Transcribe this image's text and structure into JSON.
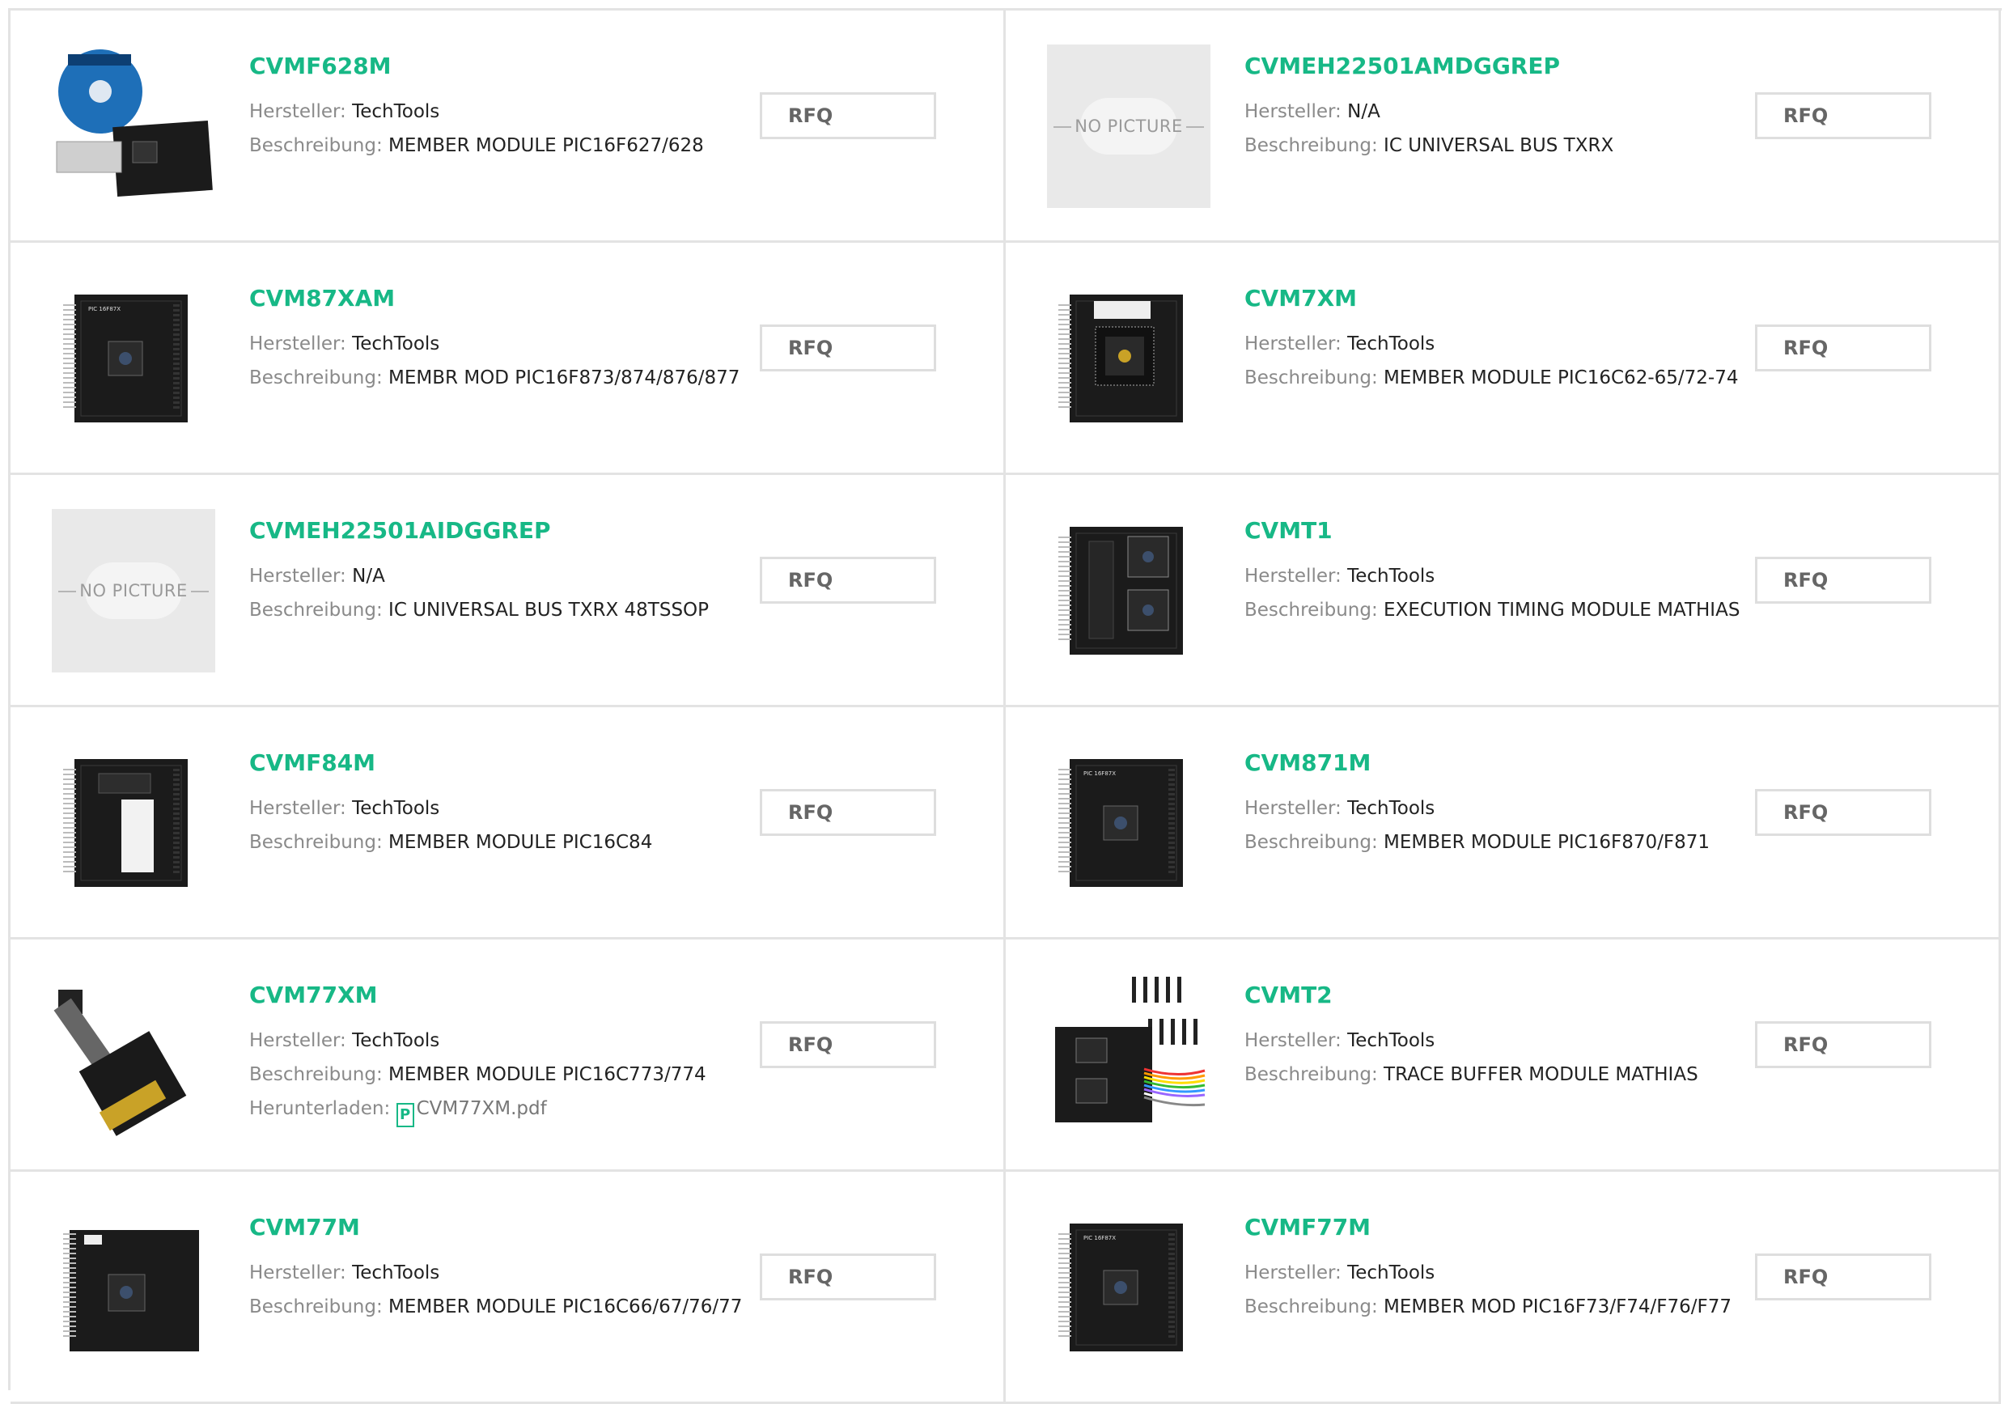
{
  "labels": {
    "manufacturer": "Hersteller:",
    "description": "Beschreibung:",
    "download": "Herunterladen:",
    "no_picture": "NO PICTURE",
    "rfq": "RFQ",
    "pdf_icon_glyph": "P"
  },
  "products": [
    {
      "part": "CVMF628M",
      "manufacturer": "TechTools",
      "description": "MEMBER MODULE PIC16F627/628",
      "image": "cd-and-board"
    },
    {
      "part": "CVMEH22501AMDGGREP",
      "manufacturer": "N/A",
      "description": "IC UNIVERSAL BUS TXRX",
      "image": "no-picture"
    },
    {
      "part": "CVM87XAM",
      "manufacturer": "TechTools",
      "description": "MEMBR MOD PIC16F873/874/876/877",
      "image": "board"
    },
    {
      "part": "CVM7XM",
      "manufacturer": "TechTools",
      "description": "MEMBER MODULE PIC16C62-65/72-74",
      "image": "board-big-chip"
    },
    {
      "part": "CVMEH22501AIDGGREP",
      "manufacturer": "N/A",
      "description": "IC UNIVERSAL BUS TXRX 48TSSOP",
      "image": "no-picture"
    },
    {
      "part": "CVMT1",
      "manufacturer": "TechTools",
      "description": "EXECUTION TIMING MODULE MATHIAS",
      "image": "board-two-chips"
    },
    {
      "part": "CVMF84M",
      "manufacturer": "TechTools",
      "description": "MEMBER MODULE PIC16C84",
      "image": "board-label"
    },
    {
      "part": "CVM871M",
      "manufacturer": "TechTools",
      "description": "MEMBER MODULE PIC16F870/F871",
      "image": "board"
    },
    {
      "part": "CVM77XM",
      "manufacturer": "TechTools",
      "description": "MEMBER MODULE PIC16C773/774",
      "image": "ribbon-adapter",
      "download": "CVM77XM.pdf"
    },
    {
      "part": "CVMT2",
      "manufacturer": "TechTools",
      "description": "TRACE BUFFER MODULE MATHIAS",
      "image": "board-with-probes"
    },
    {
      "part": "CVM77M",
      "manufacturer": "TechTools",
      "description": "MEMBER MODULE PIC16C66/67/76/77",
      "image": "board-wide"
    },
    {
      "part": "CVMF77M",
      "manufacturer": "TechTools",
      "description": "MEMBER MOD PIC16F73/F74/F76/F77",
      "image": "board"
    }
  ],
  "colors": {
    "accent": "#17b886",
    "border": "#e3e3e3",
    "label": "#8a8a8a"
  }
}
